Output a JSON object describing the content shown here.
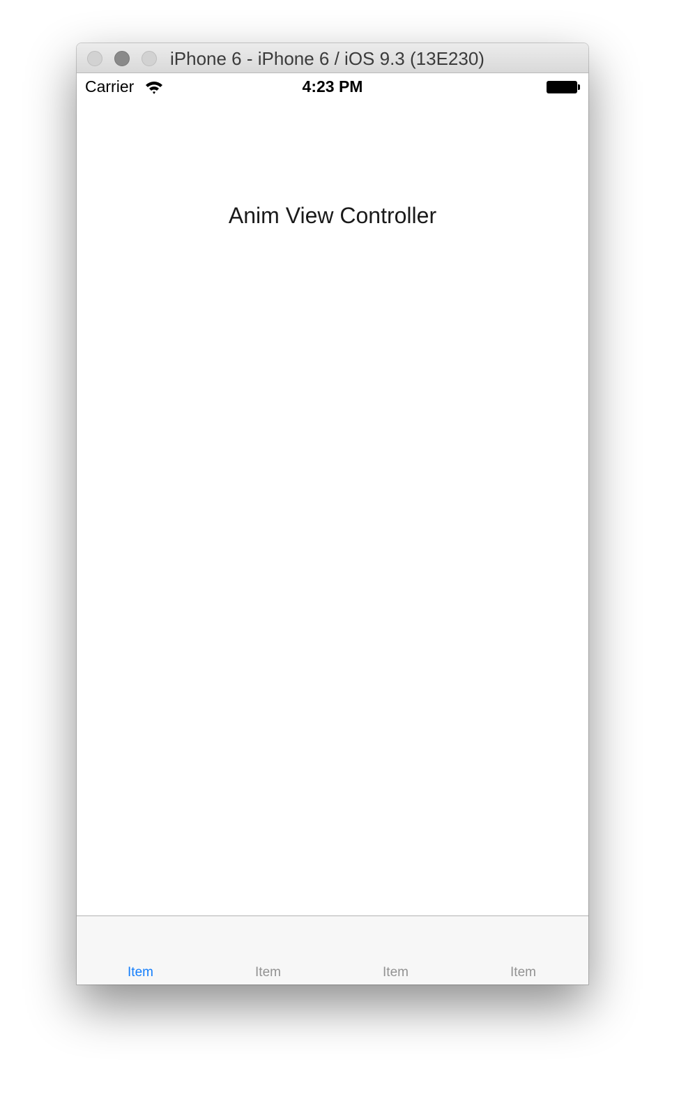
{
  "window": {
    "title": "iPhone 6 - iPhone 6 / iOS 9.3 (13E230)"
  },
  "status_bar": {
    "carrier": "Carrier",
    "time": "4:23 PM",
    "wifi_icon": "wifi-icon",
    "battery_icon": "battery-icon"
  },
  "main": {
    "label": "Anim View Controller"
  },
  "tab_bar": {
    "selected_color": "#147efb",
    "unselected_color": "#929292",
    "items": [
      {
        "label": "Item",
        "selected": true
      },
      {
        "label": "Item",
        "selected": false
      },
      {
        "label": "Item",
        "selected": false
      },
      {
        "label": "Item",
        "selected": false
      }
    ]
  }
}
